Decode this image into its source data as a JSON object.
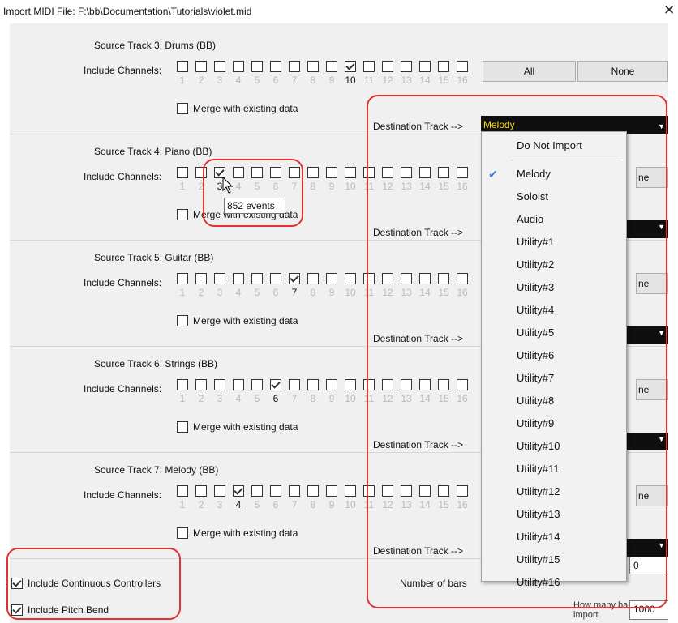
{
  "window": {
    "title": "Import MIDI File: F:\\bb\\Documentation\\Tutorials\\violet.mid",
    "close_glyph": "✕"
  },
  "channel_numbers": [
    "1",
    "2",
    "3",
    "4",
    "5",
    "6",
    "7",
    "8",
    "9",
    "10",
    "11",
    "12",
    "13",
    "14",
    "15",
    "16"
  ],
  "common": {
    "include_channels": "Include Channels:",
    "merge": "Merge with existing data",
    "destination": "Destination Track -->",
    "all": "All",
    "none": "None",
    "ne_fragment": "ne"
  },
  "tracks": [
    {
      "source": "Source Track 3: Drums  (BB)",
      "checked_channel": 10,
      "destination": "Melody"
    },
    {
      "source": "Source Track 4: Piano  (BB)",
      "checked_channel": 3,
      "destination": ""
    },
    {
      "source": "Source Track 5: Guitar  (BB)",
      "checked_channel": 7,
      "destination": ""
    },
    {
      "source": "Source Track 6: Strings (BB)",
      "checked_channel": 6,
      "destination": ""
    },
    {
      "source": "Source Track 7: Melody  (BB)",
      "checked_channel": 4,
      "destination": ""
    }
  ],
  "tooltip": "852 events",
  "dropdown": {
    "selected": "Melody",
    "items": [
      "Do Not Import",
      "Melody",
      "Soloist",
      "Audio",
      "Utility#1",
      "Utility#2",
      "Utility#3",
      "Utility#4",
      "Utility#5",
      "Utility#6",
      "Utility#7",
      "Utility#8",
      "Utility#9",
      "Utility#10",
      "Utility#11",
      "Utility#12",
      "Utility#13",
      "Utility#14",
      "Utility#15",
      "Utility#16"
    ]
  },
  "bottom": {
    "continuous_controllers": "Include Continuous Controllers",
    "pitch_bend": "Include Pitch Bend",
    "number_of_bars_label": "Number of bars",
    "number_of_bars_value": "0",
    "how_many_bars_label": "How many bars to import",
    "how_many_bars_value": "1000"
  },
  "colors": {
    "highlight_red": "#e53030",
    "destination_text": "#ffd800",
    "selection_check": "#3b7ad8"
  },
  "icons": [
    "close-icon",
    "checkmark-icon",
    "dropdown-arrow-icon",
    "mouse-cursor-icon"
  ]
}
